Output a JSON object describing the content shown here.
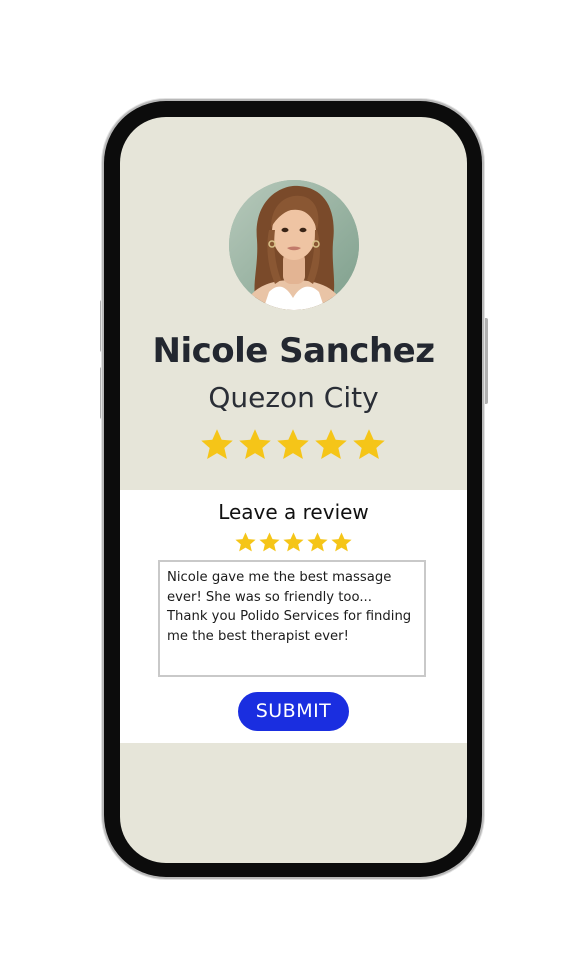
{
  "profile": {
    "name": "Nicole Sanchez",
    "location": "Quezon City",
    "rating": 5,
    "avatar_icon": "woman-portrait"
  },
  "review": {
    "title": "Leave a review",
    "rating": 5,
    "text": "Nicole gave me the best massage\never! She was so friendly too...\nThank you Polido Services for finding\nme the best therapist ever!",
    "submit_label": "SUBMIT"
  },
  "colors": {
    "screen_background": "#e6e5d9",
    "star": "#f5c518",
    "submit_button": "#1a2ee0",
    "name_text": "#232730"
  },
  "icons": {
    "star": "star-icon"
  }
}
